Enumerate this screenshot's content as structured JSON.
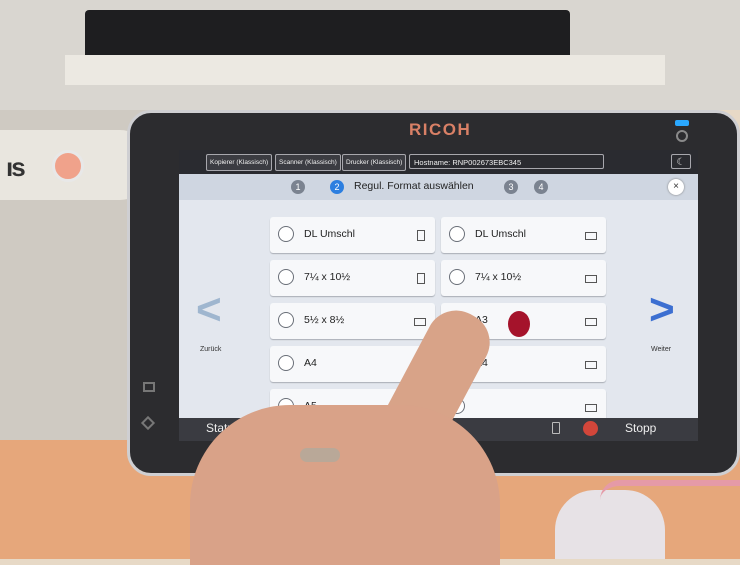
{
  "device": {
    "brand": "RICOH"
  },
  "top_bar": {
    "tabs": [
      "Kopierer (Klassisch)",
      "Scanner (Klassisch)",
      "Drucker (Klassisch)"
    ],
    "hostname": "Hostname: RNP002673EBC345"
  },
  "wizard": {
    "steps": [
      "1",
      "2",
      "3",
      "4"
    ],
    "active_step": 2,
    "title": "Regul. Format auswählen",
    "close_symbol": "×"
  },
  "navigation": {
    "prev_label": "Zurück",
    "next_label": "Weiter",
    "prev_symbol": "<",
    "next_symbol": ">"
  },
  "options": {
    "left": [
      {
        "label": "DL Umschl",
        "orientation": "portrait"
      },
      {
        "label": "7¼ x 10½",
        "orientation": "portrait"
      },
      {
        "label": "5½ x 8½",
        "orientation": "landscape"
      },
      {
        "label": "A4",
        "orientation": "portrait"
      },
      {
        "label": "A5",
        "orientation": "portrait"
      }
    ],
    "right": [
      {
        "label": "DL Umschl",
        "orientation": "landscape"
      },
      {
        "label": "7¼ x 10½",
        "orientation": "landscape"
      },
      {
        "label": "A3",
        "orientation": "landscape"
      },
      {
        "label": "A4",
        "orientation": "landscape"
      },
      {
        "label": "",
        "orientation": "landscape"
      }
    ]
  },
  "bottom_bar": {
    "status_label": "Status prüfen",
    "back_symbol": "↶",
    "stop_label": "Stopp"
  },
  "colors": {
    "brand": "#d98066",
    "active_step": "#2d7fe0",
    "next_arrow": "#3c6fd1",
    "stop": "#d2463a"
  }
}
